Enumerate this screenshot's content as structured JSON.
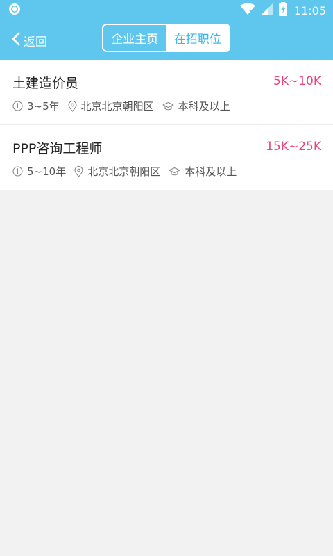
{
  "status_bar": {
    "time": "11:05",
    "icons": [
      "app-notification-icon",
      "wifi-icon",
      "signal-icon",
      "battery-charging-icon"
    ]
  },
  "header": {
    "back_label": "返回",
    "tabs": [
      {
        "label": "企业主页",
        "active": false
      },
      {
        "label": "在招职位",
        "active": true
      }
    ]
  },
  "jobs": [
    {
      "title": "土建造价员",
      "salary": "5K~10K",
      "experience": "3~5年",
      "location": "北京北京朝阳区",
      "education": "本科及以上"
    },
    {
      "title": "PPP咨询工程师",
      "salary": "15K~25K",
      "experience": "5~10年",
      "location": "北京北京朝阳区",
      "education": "本科及以上"
    }
  ],
  "colors": {
    "accent": "#5fc7ee",
    "active_tab_text": "#3cb8e8",
    "salary": "#e8467a",
    "background": "#f2f2f2"
  }
}
